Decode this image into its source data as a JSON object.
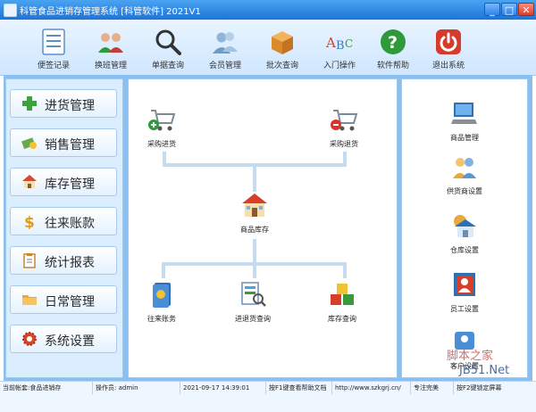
{
  "window": {
    "title": "科管食品进销存管理系统 [科管软件] 2021V1",
    "min_symbol": "_",
    "max_symbol": "□",
    "close_symbol": "✕"
  },
  "toolbar": {
    "items": [
      {
        "label": "便签记录",
        "icon": "notepad-icon"
      },
      {
        "label": "换班管理",
        "icon": "people-group-icon"
      },
      {
        "label": "单据查询",
        "icon": "magnifier-icon"
      },
      {
        "label": "会员管理",
        "icon": "members-icon"
      },
      {
        "label": "批次查询",
        "icon": "box-icon"
      },
      {
        "label": "入门操作",
        "icon": "abc-icon"
      },
      {
        "label": "软件帮助",
        "icon": "help-icon"
      },
      {
        "label": "退出系统",
        "icon": "power-icon"
      }
    ]
  },
  "sidebar": {
    "items": [
      {
        "label": "进货管理",
        "icon": "plus-icon"
      },
      {
        "label": "销售管理",
        "icon": "money-icon"
      },
      {
        "label": "库存管理",
        "icon": "home-icon"
      },
      {
        "label": "往来账款",
        "icon": "dollar-icon"
      },
      {
        "label": "统计报表",
        "icon": "report-icon"
      },
      {
        "label": "日常管理",
        "icon": "folder-icon"
      },
      {
        "label": "系统设置",
        "icon": "settings-icon"
      }
    ]
  },
  "flow": {
    "purchase_in": "采购进货",
    "purchase_return": "采购退货",
    "stock": "商品库存",
    "accounts": "往来账务",
    "in_out_query": "进退货查询",
    "stock_query": "库存查询"
  },
  "right_panel": {
    "items": [
      {
        "label": "商品管理",
        "icon": "computer-icon"
      },
      {
        "label": "供货商设置",
        "icon": "supplier-icon"
      },
      {
        "label": "仓库设置",
        "icon": "warehouse-icon"
      },
      {
        "label": "员工设置",
        "icon": "staff-icon"
      },
      {
        "label": "客户设置",
        "icon": "customer-icon"
      }
    ]
  },
  "watermark": {
    "line1": "脚本之家",
    "line2": "JB51.Net"
  },
  "status": {
    "account": "当前帐套:食品进销存",
    "operator": "操作员: admin",
    "datetime": "2021-09-17 14:39:01",
    "help_hint": "按F1键查看帮助文档",
    "url": "http://www.szkgrj.cn/",
    "slogan": "专注完美",
    "lock_hint": "按F2键锁定屏幕"
  }
}
